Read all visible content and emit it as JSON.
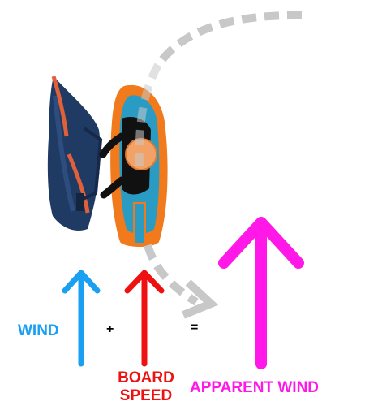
{
  "labels": {
    "wind": "WIND",
    "plus": "+",
    "board_speed_line1": "BOARD",
    "board_speed_line2": "SPEED",
    "equals": "=",
    "apparent_wind": "APPARENT WIND"
  },
  "colors": {
    "wind": "#1aa0f2",
    "board_speed": "#ee1111",
    "apparent_wind": "#ff18e8",
    "path": "#c8c8c8",
    "board_orange": "#f07a1c",
    "board_blue": "#2a9cc4",
    "sail_navy": "#1f3a63",
    "sail_trim": "#e0603a"
  },
  "icons": {
    "rider": "kite-foil-rider-top-view-illustration",
    "path": "curved-dashed-trajectory-arrow"
  }
}
